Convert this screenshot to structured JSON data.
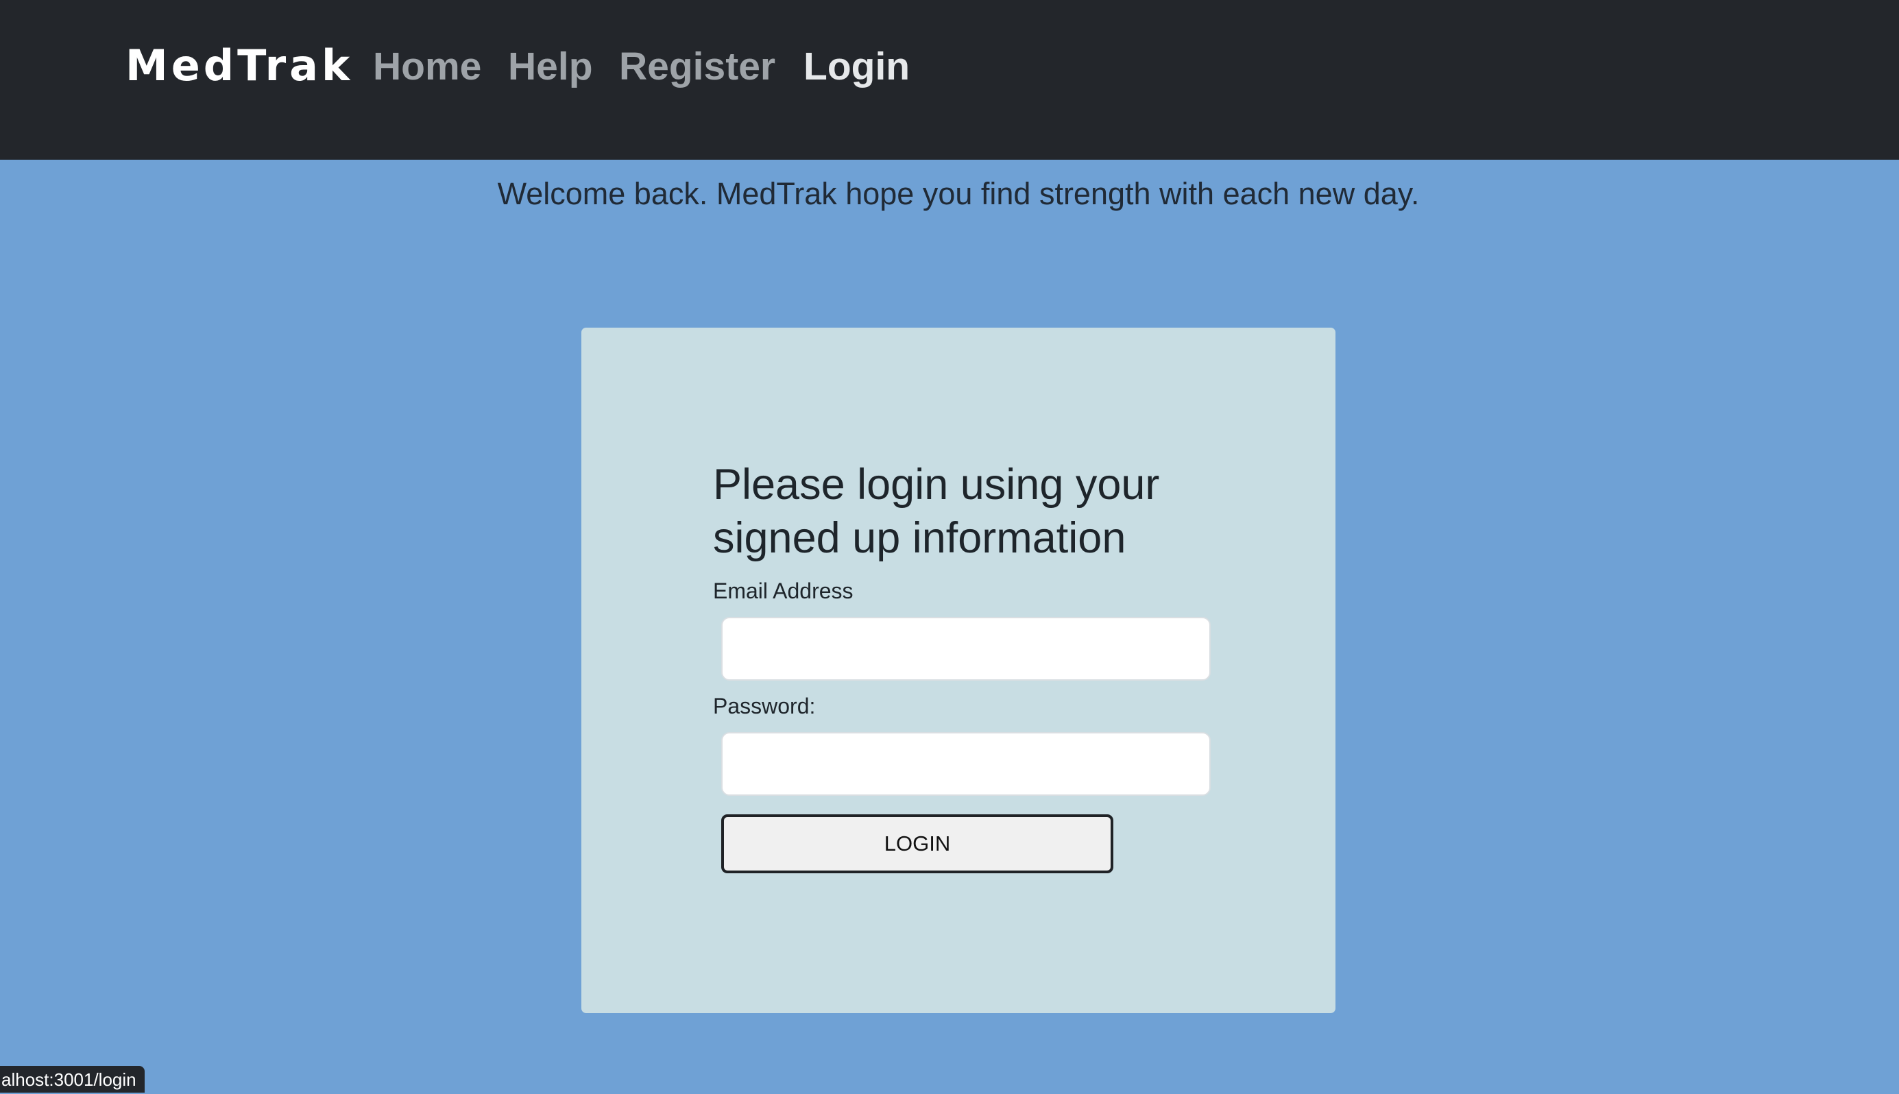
{
  "navbar": {
    "brand": "MedTrak",
    "links": [
      {
        "label": "Home",
        "active": false
      },
      {
        "label": "Help",
        "active": false
      },
      {
        "label": "Register",
        "active": false
      },
      {
        "label": "Login",
        "active": true
      }
    ]
  },
  "welcome_message": "Welcome back. MedTrak hope you find strength with each new day.",
  "login_form": {
    "title": "Please login using your signed up information",
    "email_label": "Email Address",
    "email_value": "",
    "password_label": "Password:",
    "password_value": "",
    "submit_label": "LOGIN"
  },
  "status_bar": {
    "url_text": "alhost:3001/login"
  },
  "colors": {
    "navbar_background": "#23262b",
    "page_background": "#6fa1d5",
    "card_background": "#c8dde3",
    "nav_link_inactive": "#9ea3a8",
    "nav_link_active": "#e6e8ea"
  }
}
